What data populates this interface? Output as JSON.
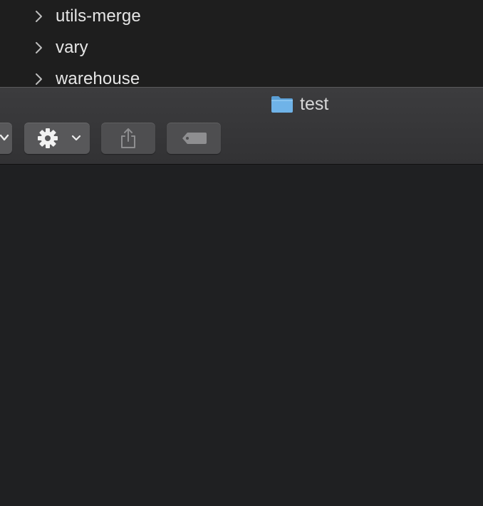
{
  "background_list": {
    "items": [
      {
        "label": "utils-merge"
      },
      {
        "label": "vary"
      },
      {
        "label": "warehouse"
      }
    ]
  },
  "window": {
    "title": "test",
    "title_icon": "folder-icon",
    "toolbar": {
      "buttons": [
        {
          "name": "view-options-button",
          "icon": "chevron-down-icon"
        },
        {
          "name": "action-menu-button",
          "icon": "gear-icon"
        },
        {
          "name": "share-button",
          "icon": "share-icon"
        },
        {
          "name": "tags-button",
          "icon": "tag-icon"
        }
      ]
    }
  },
  "colors": {
    "background": "#1f2022",
    "toolbar_button": "#58585a",
    "folder": "#6fb3e8",
    "text": "#e6e6e6"
  }
}
